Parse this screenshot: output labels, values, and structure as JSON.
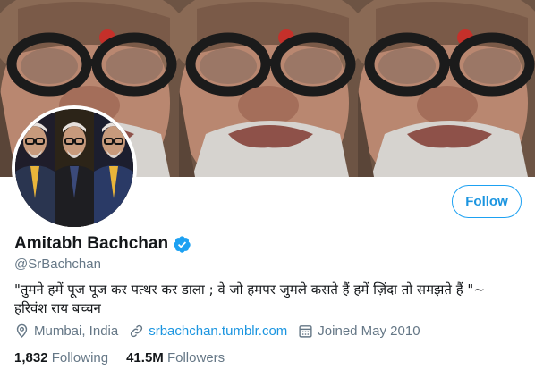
{
  "profile": {
    "display_name": "Amitabh Bachchan",
    "handle": "@SrBachchan",
    "verified": true,
    "bio_line1": "\"तुमने हमें पूज पूज कर पत्थर कर डाला ; वे जो हमपर जुमले कसते हैं हमें ज़िंदा तो समझते हैं \"~",
    "bio_line2": "हरिवंश राय  बच्चन",
    "location": "Mumbai, India",
    "website": "srbachchan.tumblr.com",
    "joined": "Joined May 2010",
    "following_count": "1,832",
    "following_label": "Following",
    "followers_count": "41.5M",
    "followers_label": "Followers"
  },
  "actions": {
    "follow_label": "Follow"
  },
  "colors": {
    "accent": "#1da1f2",
    "link": "#1b95e0",
    "muted": "#657786",
    "text": "#14171a"
  },
  "icons": [
    "location-icon",
    "link-icon",
    "calendar-icon",
    "verified-badge-icon"
  ]
}
